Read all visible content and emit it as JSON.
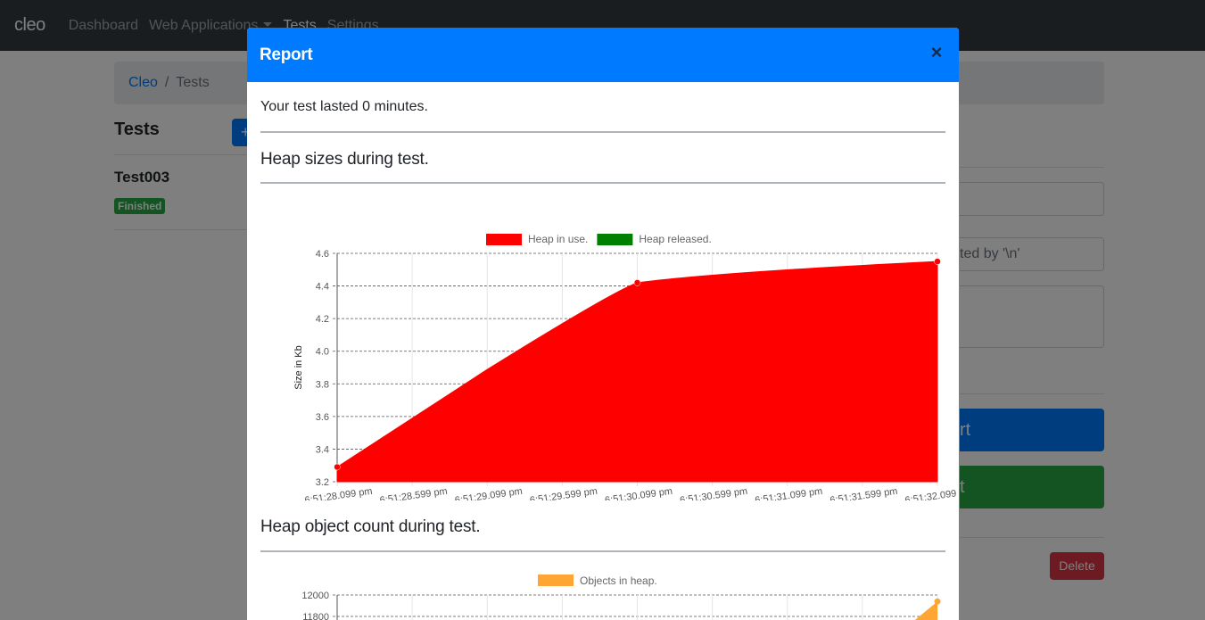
{
  "navbar": {
    "brand": "cleo",
    "links": [
      "Dashboard",
      "Web Applications",
      "Tests",
      "Settings"
    ]
  },
  "breadcrumb": {
    "root": "Cleo",
    "separator": "/",
    "current": "Tests"
  },
  "sidebar": {
    "title": "Tests",
    "add_label": "+",
    "test_name": "Test003",
    "status": "Finished"
  },
  "right_panel": {
    "input_visible_text": "ted by '\\n'",
    "primary_button_fragment": "rt",
    "success_button_fragment": "t",
    "delete_label": "Delete"
  },
  "colors": {
    "brand_blue": "#007bff",
    "heap_in_use": "#ff0000",
    "heap_released": "#008000",
    "objects_in_heap": "#ffa533",
    "delete_red": "#dc3545",
    "badge_green": "#28a745"
  },
  "modal": {
    "title": "Report",
    "close_icon": "close-icon",
    "duration_text": "Your test lasted 0 minutes.",
    "section1_title": "Heap sizes during test.",
    "section2_title": "Heap object count during test."
  },
  "chart_data": [
    {
      "type": "area",
      "title": "",
      "ylabel": "Size in Kb",
      "xlabel": "",
      "ylim": [
        3.2,
        4.6
      ],
      "yticks": [
        "3.2",
        "3.4",
        "3.6",
        "3.8",
        "4.0",
        "4.2",
        "4.4",
        "4.6"
      ],
      "x": [
        "6:51:28.099 pm",
        "6:51:28.599 pm",
        "6:51:29.099 pm",
        "6:51:29.599 pm",
        "6:51:30.099 pm",
        "6:51:30.599 pm",
        "6:51:31.099 pm",
        "6:51:31.599 pm",
        "6:51:32.099 pm"
      ],
      "grid": true,
      "legend": "top",
      "series": [
        {
          "name": "Heap in use.",
          "color": "#ff0000",
          "points": [
            {
              "x": 0,
              "y": 3.29
            },
            {
              "x": 4,
              "y": 4.42
            },
            {
              "x": 8,
              "y": 4.55
            }
          ]
        },
        {
          "name": "Heap released.",
          "color": "#008000",
          "points": []
        }
      ]
    },
    {
      "type": "area",
      "title": "",
      "ylabel": "",
      "yticks": [
        "12000",
        "11800"
      ],
      "ylim_visible": [
        11800,
        12000
      ],
      "grid": true,
      "legend": "top",
      "series": [
        {
          "name": "Objects in heap.",
          "color": "#ffa533",
          "points": [
            {
              "x": 8,
              "y": 11940
            }
          ]
        }
      ]
    }
  ]
}
